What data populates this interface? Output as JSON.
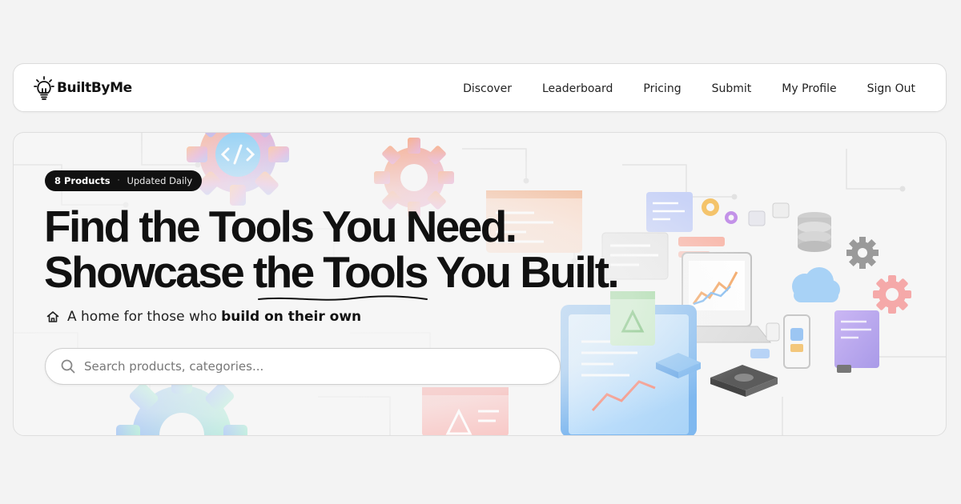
{
  "brand": {
    "name": "BuiltByMe",
    "icon": "lightbulb-icon"
  },
  "nav": {
    "links": [
      {
        "label": "Discover"
      },
      {
        "label": "Leaderboard"
      },
      {
        "label": "Pricing"
      },
      {
        "label": "Submit"
      },
      {
        "label": "My Profile"
      },
      {
        "label": "Sign Out"
      }
    ]
  },
  "hero": {
    "badge": {
      "count": "8 Products",
      "separator": "·",
      "update": "Updated Daily"
    },
    "headline": {
      "line1": "Find the Tools You Need.",
      "line2": "Showcase the Tools You Built."
    },
    "tagline": {
      "icon": "home-icon",
      "text": "A home for those who",
      "bold": "build on their own"
    },
    "search": {
      "icon": "search-icon",
      "placeholder": "Search products, categories..."
    }
  },
  "colors": {
    "page_background": "#f3f3f3",
    "card_background": "#ffffff",
    "text_primary": "#111111",
    "badge_background": "#111111"
  }
}
